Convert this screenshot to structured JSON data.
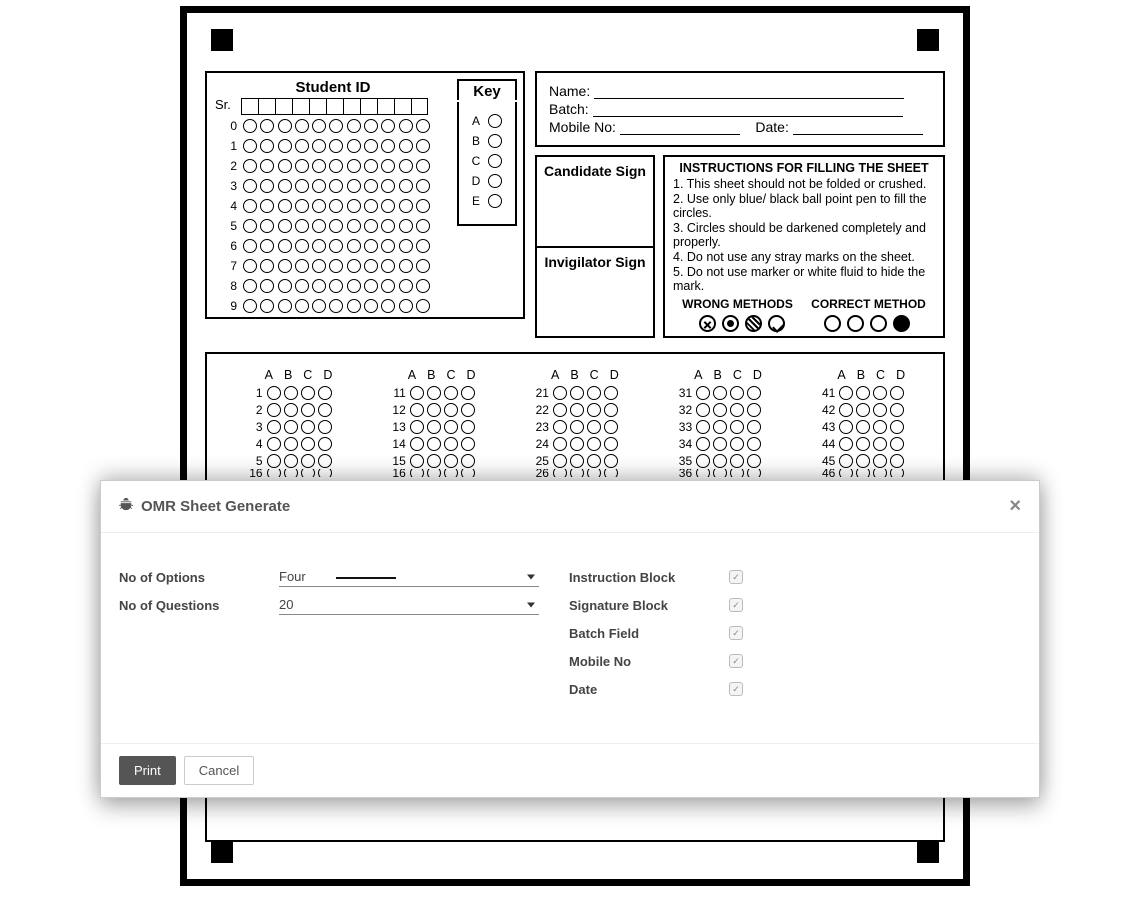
{
  "sheet": {
    "student_id_label": "Student ID",
    "sr_label": "Sr.",
    "digits": [
      "0",
      "1",
      "2",
      "3",
      "4",
      "5",
      "6",
      "7",
      "8",
      "9"
    ],
    "id_columns": 11,
    "key_label": "Key",
    "key_options": [
      "A",
      "B",
      "C",
      "D",
      "E"
    ],
    "info": {
      "name_label": "Name:",
      "batch_label": "Batch:",
      "mobile_label": "Mobile No:",
      "date_label": "Date:"
    },
    "candidate_sign": "Candidate Sign",
    "invigilator_sign": "Invigilator Sign",
    "instructions_title": "INSTRUCTIONS FOR FILLING THE SHEET",
    "instructions": [
      "1. This sheet should not be folded or crushed.",
      "2. Use only blue/ black ball point pen to fill the circles.",
      "3. Circles should be darkened completely and properly.",
      "4. Do not use any stray marks on the sheet.",
      "5. Do not use marker or white fluid to hide the mark."
    ],
    "wrong_methods_label": "WRONG METHODS",
    "correct_method_label": "CORRECT METHOD",
    "answer_headers": [
      "A",
      "B",
      "C",
      "D"
    ],
    "columns": [
      {
        "start": 1,
        "count": 5,
        "extra": "16"
      },
      {
        "start": 11,
        "count": 5,
        "extra": "16"
      },
      {
        "start": 21,
        "count": 5,
        "extra": "26"
      },
      {
        "start": 31,
        "count": 5,
        "extra": "36"
      },
      {
        "start": 41,
        "count": 5,
        "extra": "46"
      }
    ]
  },
  "dialog": {
    "title": "OMR Sheet Generate",
    "no_of_options_label": "No of Options",
    "no_of_questions_label": "No of Questions",
    "options_value": "Four",
    "questions_value": "20",
    "instruction_block_label": "Instruction Block",
    "signature_block_label": "Signature Block",
    "batch_field_label": "Batch Field",
    "mobile_no_label": "Mobile No",
    "date_label": "Date",
    "checked": {
      "instruction": true,
      "signature": true,
      "batch": true,
      "mobile": true,
      "date": true
    },
    "print_label": "Print",
    "cancel_label": "Cancel"
  }
}
